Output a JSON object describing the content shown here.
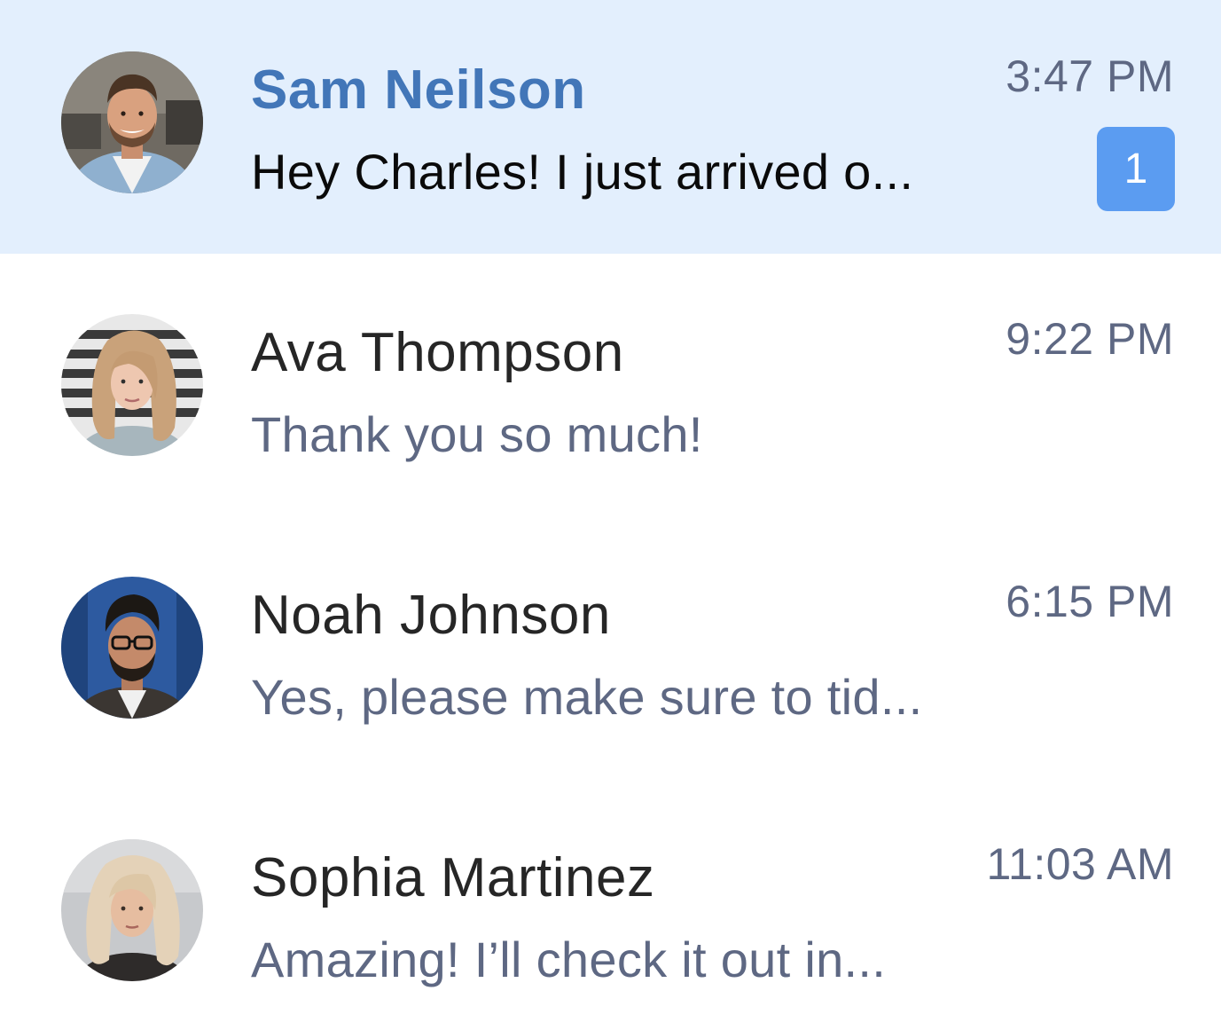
{
  "conversations": [
    {
      "name": "Sam Neilson",
      "preview": "Hey Charles! I just arrived o...",
      "time": "3:47 PM",
      "unread": "1",
      "active": true,
      "avatar": "avatar-man-smiling-beard"
    },
    {
      "name": "Ava Thompson",
      "preview": "Thank you so much!",
      "time": "9:22 PM",
      "active": false,
      "avatar": "avatar-woman-blonde"
    },
    {
      "name": "Noah Johnson",
      "preview": "Yes, please make sure to tid...",
      "time": "6:15 PM",
      "active": false,
      "avatar": "avatar-man-glasses-beard"
    },
    {
      "name": "Sophia Martinez",
      "preview": "Amazing! I’ll check it out in...",
      "time": "11:03 AM",
      "active": false,
      "avatar": "avatar-woman-platinum-hair"
    }
  ],
  "colors": {
    "active_background": "#e3effd",
    "active_name": "#4276b8",
    "badge": "#5b9cf1",
    "muted_text": "#5e6883"
  }
}
